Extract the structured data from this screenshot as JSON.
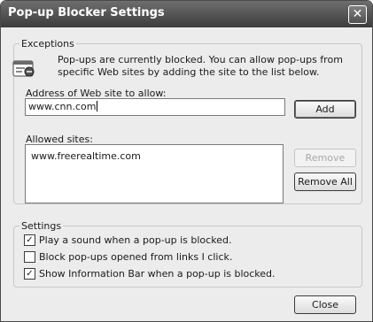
{
  "window": {
    "title": "Pop-up Blocker Settings",
    "close_glyph": "✕"
  },
  "exceptions": {
    "legend": "Exceptions",
    "info_icon": "popup-blocked-icon",
    "info_text": "Pop-ups are currently blocked.  You can allow pop-ups from specific Web sites by adding the site to the list below.",
    "address_label": "Address of Web site to allow:",
    "address_value": "www.cnn.com",
    "add_label": "Add",
    "allowed_label": "Allowed sites:",
    "allowed_sites": [
      "www.freerealtime.com"
    ],
    "remove_label": "Remove",
    "remove_all_label": "Remove All"
  },
  "settings": {
    "legend": "Settings",
    "options": [
      {
        "label": "Play a sound when a pop-up is blocked.",
        "checked": true
      },
      {
        "label": "Block pop-ups opened from links I click.",
        "checked": false
      },
      {
        "label": "Show Information Bar when a pop-up is blocked.",
        "checked": true
      }
    ]
  },
  "footer": {
    "close_label": "Close"
  }
}
